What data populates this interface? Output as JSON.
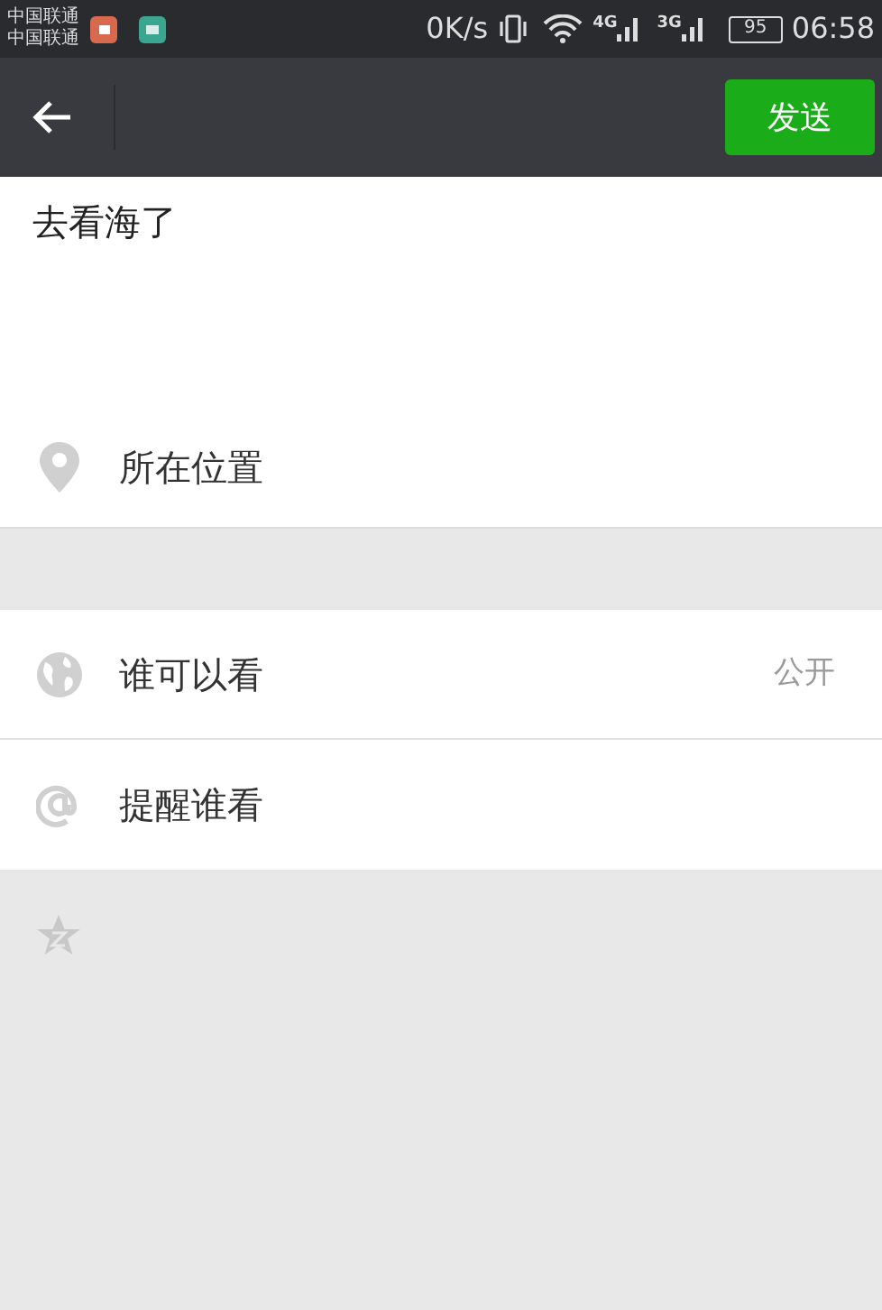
{
  "status_bar": {
    "carriers": [
      "中国联通",
      "中国联通"
    ],
    "speed": "0K/s",
    "network_1": "4G",
    "network_2": "3G",
    "battery": "95",
    "time": "06:58"
  },
  "nav": {
    "send_button": "发送"
  },
  "post": {
    "value": "去看海了"
  },
  "location": {
    "kind": "location",
    "label": "所在位置"
  },
  "options": [
    {
      "kind": "globe",
      "label": "谁可以看",
      "value": "公开"
    },
    {
      "kind": "mention",
      "label": "提醒谁看"
    }
  ]
}
